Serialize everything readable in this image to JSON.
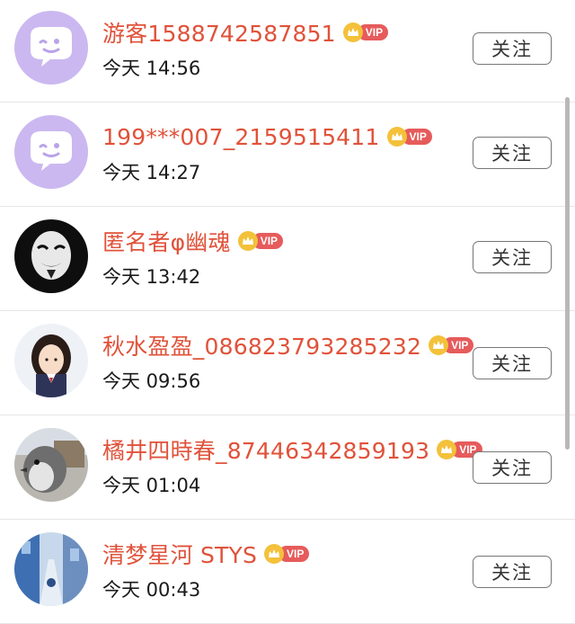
{
  "accent_name_color": "#e0523a",
  "vip_label": "VIP",
  "follow_label": "关注",
  "items": [
    {
      "name": "游客1588742587851",
      "time": "今天 14:56",
      "avatar": "chat-bubble-avatar"
    },
    {
      "name": "199***007_2159515411",
      "time": "今天 14:27",
      "avatar": "chat-bubble-avatar"
    },
    {
      "name": "匿名者φ幽魂",
      "time": "今天 13:42",
      "avatar": "mask-avatar"
    },
    {
      "name": "秋水盈盈_086823793285232",
      "time": "今天 09:56",
      "avatar": "girl-photo-avatar"
    },
    {
      "name": "橘井四時春_87446342859193",
      "time": "今天 01:04",
      "avatar": "penguin-photo-avatar"
    },
    {
      "name": "清梦星河 STYS",
      "time": "今天 00:43",
      "avatar": "street-photo-avatar"
    }
  ]
}
